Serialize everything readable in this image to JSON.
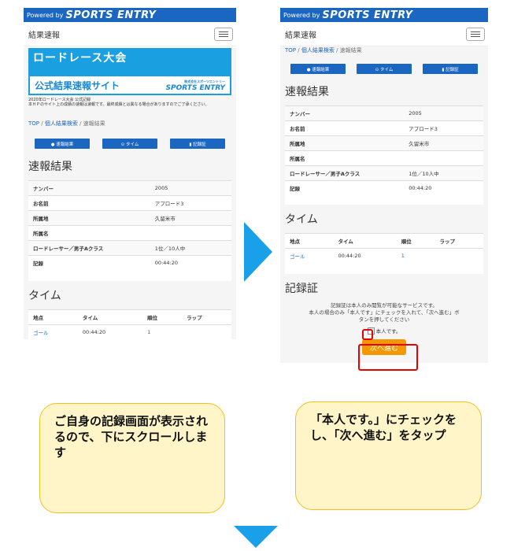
{
  "topbar": {
    "powered": "Powered by",
    "brand": "SPORTS ENTRY"
  },
  "nav": {
    "title": "結果速報"
  },
  "banner": {
    "title": "ロードレース大会",
    "subtitle": "公式結果速報サイト",
    "logo_small": "株式会社スポーツエントリー",
    "logo": "SPORTS ENTRY"
  },
  "notice": {
    "line1": "2020年ロードレース大会 公式記録",
    "line2": "本ＨＰのサイト上の成績の速報は速報です。最終成績とは異なる場合がありますのでご了承ください。"
  },
  "breadcrumb": {
    "top": "TOP",
    "search": "個人結果検索",
    "current": "速報結果",
    "sep": "/"
  },
  "buttons": {
    "result": "● 速報結果",
    "time": "⊙ タイム",
    "cert": "▮ 記録証"
  },
  "result_section": {
    "heading": "速報結果",
    "rows": [
      {
        "key": "ナンバー",
        "value": "2005"
      },
      {
        "key": "お名前",
        "value": "アプロード3"
      },
      {
        "key": "所属地",
        "value": "久留米市"
      },
      {
        "key": "所属名",
        "value": ""
      },
      {
        "key": "ロードレーサー／男子Aクラス",
        "value": "1位／10人中"
      },
      {
        "key": "記録",
        "value": "00:44:20"
      }
    ]
  },
  "time_section": {
    "heading": "タイム",
    "headers": [
      "地点",
      "タイム",
      "順位",
      "ラップ"
    ],
    "row": [
      "ゴール",
      "00:44:20",
      "1",
      ""
    ]
  },
  "cert_section": {
    "heading": "記録証",
    "line1": "記録証は本人のみ閲覧が可能なサービスです。",
    "line2": "本人の場合のみ「本人です」にチェックを入れて、「次へ進む」ボ",
    "line3": "タンを押してください",
    "check_label": "本人です。",
    "next_button": "次へ進む"
  },
  "callouts": {
    "left": "ご自身の記録画面が表示されるので、下にスクロールします",
    "right": "「本人です。」にチェックをし、「次へ進む」をタップ"
  },
  "colors": {
    "topbar": "#1a66c0",
    "banner": "#1a9fe0",
    "next_button": "#f39800",
    "arrow": "#1aa0e8",
    "callout_bg": "#fff5c8",
    "callout_border": "#f0c020",
    "highlight": "#e60000"
  }
}
